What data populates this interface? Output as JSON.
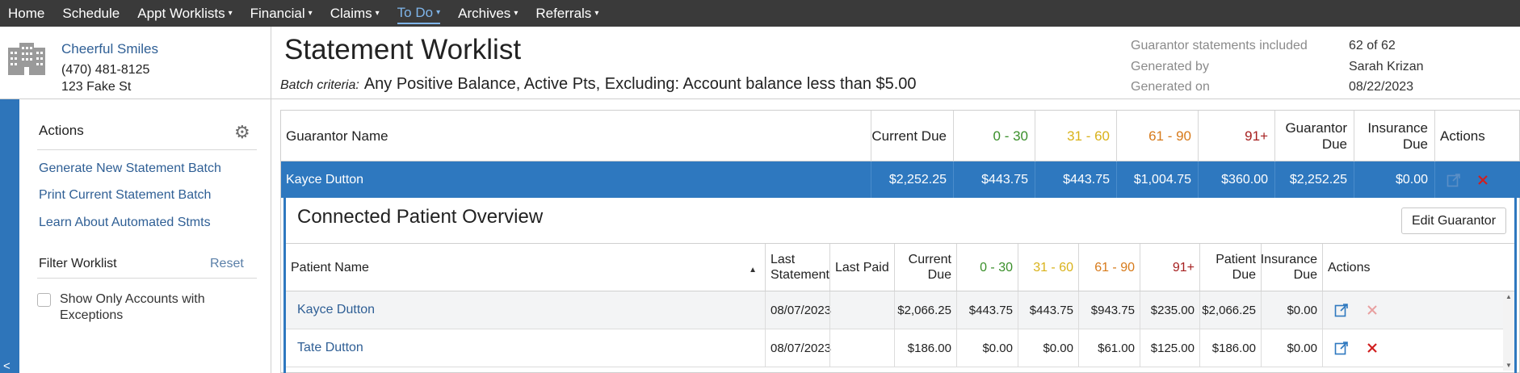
{
  "nav": {
    "items": [
      {
        "label": "Home",
        "caret": ""
      },
      {
        "label": "Schedule",
        "caret": ""
      },
      {
        "label": "Appt Worklists",
        "caret": "▾"
      },
      {
        "label": "Financial",
        "caret": "▾"
      },
      {
        "label": "Claims",
        "caret": "▾"
      },
      {
        "label": "To Do",
        "caret": "▾"
      },
      {
        "label": "Archives",
        "caret": "▾"
      },
      {
        "label": "Referrals",
        "caret": "▾"
      }
    ]
  },
  "practice": {
    "name": "Cheerful Smiles",
    "phone": "(470) 481-8125",
    "address": "123 Fake St"
  },
  "header": {
    "title": "Statement Worklist",
    "criteria_label": "Batch criteria:",
    "criteria_value": "Any Positive Balance, Active Pts, Excluding: Account balance less than $5.00",
    "meta": [
      {
        "key": "Guarantor statements included",
        "value": "62 of 62"
      },
      {
        "key": "Generated by",
        "value": "Sarah Krizan"
      },
      {
        "key": "Generated on",
        "value": "08/22/2023"
      }
    ]
  },
  "sidebar": {
    "actions_title": "Actions",
    "actions": [
      "Generate New Statement Batch",
      "Print Current Statement Batch",
      "Learn About Automated Stmts"
    ],
    "filter_title": "Filter Worklist",
    "reset_label": "Reset",
    "filter_checkbox_label": "Show Only Accounts with Exceptions",
    "collapse_glyph": "<"
  },
  "guarantor_table": {
    "headers": {
      "name": "Guarantor Name",
      "current_due": "Current Due",
      "d0_30": "0 - 30",
      "d31_60": "31 - 60",
      "d61_90": "61 - 90",
      "d91": "91+",
      "guarantor_due": "Guarantor Due",
      "insurance_due": "Insurance Due",
      "actions": "Actions"
    },
    "row": {
      "name": "Kayce Dutton",
      "current_due": "$2,252.25",
      "d0_30": "$443.75",
      "d31_60": "$443.75",
      "d61_90": "$1,004.75",
      "d91": "$360.00",
      "guarantor_due": "$2,252.25",
      "insurance_due": "$0.00"
    }
  },
  "connected_patients": {
    "title": "Connected Patient Overview",
    "edit_button": "Edit Guarantor",
    "headers": {
      "name": "Patient Name",
      "last_statement": "Last Statement",
      "last_paid": "Last Paid",
      "current_due": "Current Due",
      "d0_30": "0 - 30",
      "d31_60": "31 - 60",
      "d61_90": "61 - 90",
      "d91": "91+",
      "patient_due": "Patient Due",
      "insurance_due": "Insurance Due",
      "actions": "Actions"
    },
    "rows": [
      {
        "name": "Kayce Dutton",
        "last_statement": "08/07/2023",
        "last_paid": "",
        "current_due": "$2,066.25",
        "d0_30": "$443.75",
        "d31_60": "$443.75",
        "d61_90": "$943.75",
        "d91": "$235.00",
        "patient_due": "$2,066.25",
        "insurance_due": "$0.00"
      },
      {
        "name": "Tate Dutton",
        "last_statement": "08/07/2023",
        "last_paid": "",
        "current_due": "$186.00",
        "d0_30": "$0.00",
        "d31_60": "$0.00",
        "d61_90": "$61.00",
        "d91": "$125.00",
        "patient_due": "$186.00",
        "insurance_due": "$0.00"
      }
    ]
  },
  "colors": {
    "nav_bg": "#3a3a3a",
    "accent": "#2e78bf",
    "link": "#2f5f95",
    "aging_0_30": "#3a8f2a",
    "aging_31_60": "#d9b21a",
    "aging_61_90": "#d77a1a",
    "aging_91": "#a62020"
  }
}
